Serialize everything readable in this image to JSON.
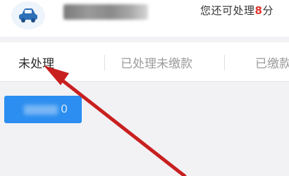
{
  "header": {
    "avatar_icon": "car-icon",
    "remaining_prefix": "您还可处理",
    "remaining_count": "8",
    "remaining_suffix": "分"
  },
  "tabs": [
    {
      "label": "未处理",
      "active": true
    },
    {
      "label": "已处理未缴款",
      "active": false
    },
    {
      "label": "已缴款",
      "active": false
    }
  ],
  "content": {
    "button_tail": "0"
  },
  "annotation": {
    "type": "arrow",
    "color": "#c8201f",
    "target": "tab-unprocessed"
  },
  "colors": {
    "accent_blue": "#2b8ef0",
    "highlight_red": "#e2342a",
    "background": "#f2f2f5"
  }
}
